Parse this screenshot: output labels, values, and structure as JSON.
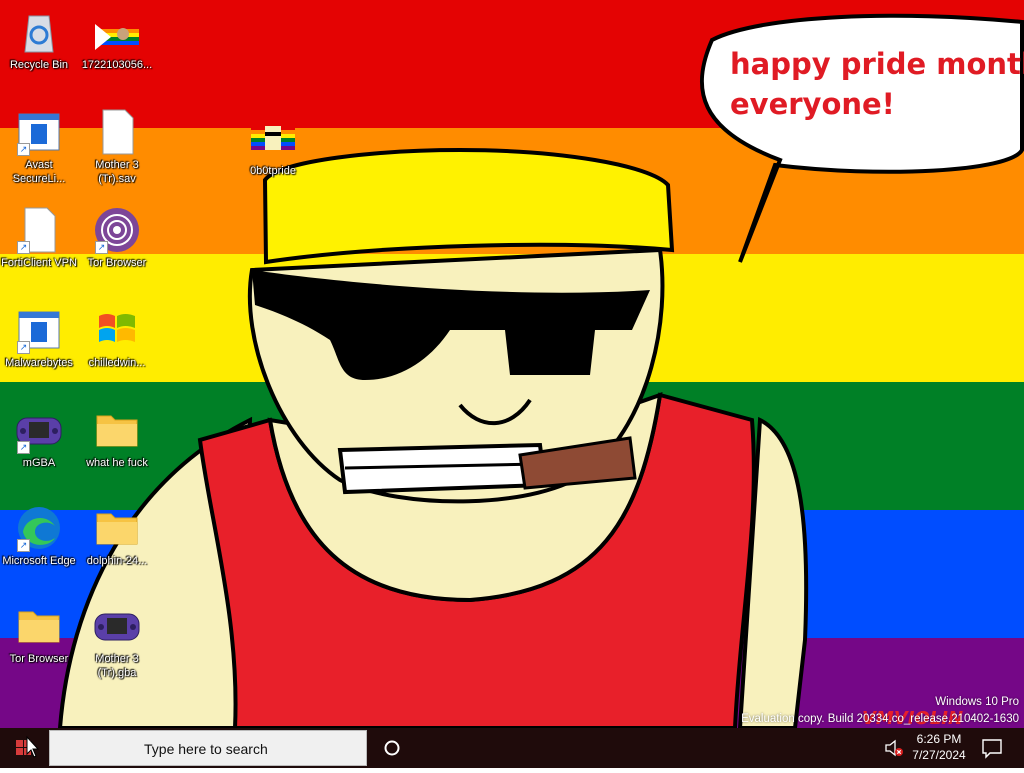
{
  "wallpaper": {
    "speech_bubble": [
      "happy pride month",
      "everyone!"
    ],
    "signature": "VMVIOLIN",
    "colors": {
      "red": "#e40303",
      "orange": "#ff8c00",
      "yellow": "#ffed00",
      "green": "#008026",
      "blue": "#004dff",
      "purple": "#750787",
      "skin": "#f8f1bd",
      "shirt": "#e8202a",
      "cigar": "#8e4a34"
    }
  },
  "desktop": {
    "icons": [
      {
        "label": "Recycle Bin",
        "icon": "recycle-bin-icon"
      },
      {
        "label": "1722103056...",
        "icon": "image-file-icon"
      },
      {
        "label": "Avast SecureLi...",
        "icon": "installer-icon"
      },
      {
        "label": "Mother 3 (Tr).sav",
        "icon": "blank-file-icon"
      },
      {
        "label": "0b0tpride",
        "icon": "image-file-icon"
      },
      {
        "label": "FortiClient VPN",
        "icon": "blank-file-icon"
      },
      {
        "label": "Tor Browser",
        "icon": "tor-icon"
      },
      {
        "label": "Malwarebytes",
        "icon": "installer-icon"
      },
      {
        "label": "chilledwin...",
        "icon": "windows-flag-icon"
      },
      {
        "label": "mGBA",
        "icon": "gba-icon"
      },
      {
        "label": "what he fuck",
        "icon": "folder-icon"
      },
      {
        "label": "Microsoft Edge",
        "icon": "edge-icon"
      },
      {
        "label": "dolphin-24...",
        "icon": "folder-icon"
      },
      {
        "label": "Tor Browser",
        "icon": "folder-icon"
      },
      {
        "label": "Mother 3 (Tr).gba",
        "icon": "gba-icon"
      }
    ]
  },
  "watermark": {
    "line1": "Windows 10 Pro",
    "line2": "Evaluation copy. Build 20334.co_release.210402-1630"
  },
  "taskbar": {
    "search_placeholder": "Type here to search",
    "time": "6:26 PM",
    "date": "7/27/2024"
  }
}
